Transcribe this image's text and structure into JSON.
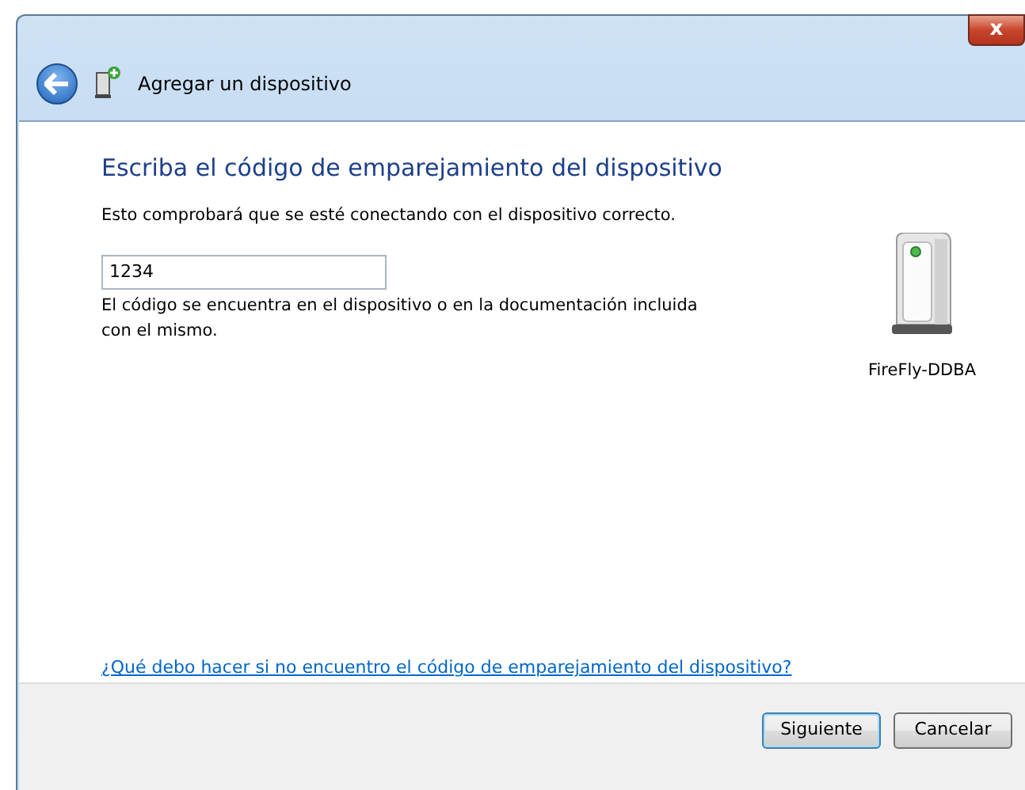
{
  "window": {
    "title": "Agregar un dispositivo",
    "close_glyph": "x"
  },
  "heading": "Escriba el código de emparejamiento del dispositivo",
  "description": "Esto comprobará que se esté conectando con el dispositivo correcto.",
  "code_field": {
    "value": "1234"
  },
  "hint": "El código se encuentra en el dispositivo o en la documentación incluida con el mismo.",
  "device": {
    "name": "FireFly-DDBA"
  },
  "help_link": "¿Qué debo hacer si no encuentro el código de emparejamiento del dispositivo?",
  "buttons": [
    {
      "label": "Siguiente",
      "kind": "default"
    },
    {
      "label": "Cancelar",
      "kind": "normal"
    }
  ]
}
